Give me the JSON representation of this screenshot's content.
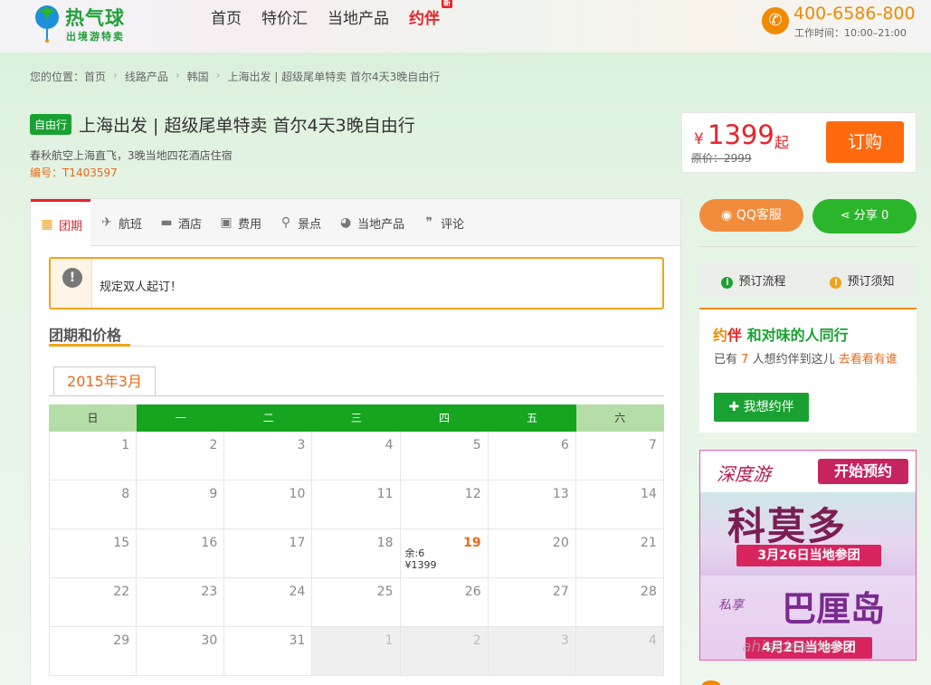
{
  "header": {
    "logo_text": "热气球",
    "logo_sub": "出境游特卖",
    "nav": [
      "首页",
      "特价汇",
      "当地产品",
      "约伴"
    ],
    "nav_new_tag": "新",
    "phone": "400-6586-800",
    "hours": "工作时间：10:00–21:00"
  },
  "breadcrumb": [
    "您的位置：首页",
    "线路产品",
    "韩国",
    "上海出发 | 超级尾单特卖 首尔4天3晚自由行"
  ],
  "product": {
    "tag": "自由行",
    "title": "上海出发 | 超级尾单特卖 首尔4天3晚自由行",
    "subtitle": "春秋航空上海直飞，3晚当地四花酒店住宿",
    "code": "编号：T1403597"
  },
  "price": {
    "currency": "¥",
    "value": "1399",
    "from": "起",
    "original": "原价：2999",
    "order_label": "订购"
  },
  "tabs": [
    {
      "label": "团期",
      "icon": "calendar-icon"
    },
    {
      "label": "航班",
      "icon": "plane-icon"
    },
    {
      "label": "酒店",
      "icon": "bed-icon"
    },
    {
      "label": "费用",
      "icon": "wallet-icon"
    },
    {
      "label": "景点",
      "icon": "location-pin-icon"
    },
    {
      "label": "当地产品",
      "icon": "globe-pin-icon"
    },
    {
      "label": "评论",
      "icon": "comment-icon"
    }
  ],
  "notice": {
    "text": "规定双人起订！",
    "icon": "!"
  },
  "section": {
    "title": "团期和价格"
  },
  "calendar": {
    "month": "2015年3月",
    "weekdays": [
      "日",
      "一",
      "二",
      "三",
      "四",
      "五",
      "六"
    ],
    "rows": [
      [
        {
          "d": "1"
        },
        {
          "d": "2"
        },
        {
          "d": "3"
        },
        {
          "d": "4"
        },
        {
          "d": "5"
        },
        {
          "d": "6"
        },
        {
          "d": "7"
        }
      ],
      [
        {
          "d": "8"
        },
        {
          "d": "9"
        },
        {
          "d": "10"
        },
        {
          "d": "11"
        },
        {
          "d": "12"
        },
        {
          "d": "13"
        },
        {
          "d": "14"
        }
      ],
      [
        {
          "d": "15"
        },
        {
          "d": "16"
        },
        {
          "d": "17"
        },
        {
          "d": "18"
        },
        {
          "d": "19",
          "left": "余:6",
          "price": "¥1399",
          "hl": true
        },
        {
          "d": "20"
        },
        {
          "d": "21"
        }
      ],
      [
        {
          "d": "22"
        },
        {
          "d": "23"
        },
        {
          "d": "24"
        },
        {
          "d": "25"
        },
        {
          "d": "26"
        },
        {
          "d": "27"
        },
        {
          "d": "28"
        }
      ],
      [
        {
          "d": "29"
        },
        {
          "d": "30"
        },
        {
          "d": "31"
        },
        {
          "d": "1",
          "other": true
        },
        {
          "d": "2",
          "other": true
        },
        {
          "d": "3",
          "other": true
        },
        {
          "d": "4",
          "other": true
        }
      ]
    ]
  },
  "sidebar": {
    "qq_label": "QQ客服",
    "share_label": "分享",
    "share_count": "0",
    "links": [
      {
        "label": "预订流程",
        "color": "#1aa132",
        "icon": "i"
      },
      {
        "label": "预订须知",
        "color": "#f3a21a",
        "icon": "!"
      }
    ],
    "buddy": {
      "brand1": "约",
      "brand2": "伴",
      "title": "和对味的人同行",
      "text_pre": "已有",
      "count": "7",
      "text_post": "人想约伴到这儿",
      "link": "去看看有谁",
      "button": "我想约伴"
    },
    "ad": {
      "logo": "深度游",
      "start": "开始预约",
      "title1": "科莫多",
      "date1": "3月26日当地参团",
      "sub2": "私享",
      "title2": "巴厘岛",
      "date2": "4月2日当地参团"
    }
  },
  "watermark": "ahiaidea.net"
}
